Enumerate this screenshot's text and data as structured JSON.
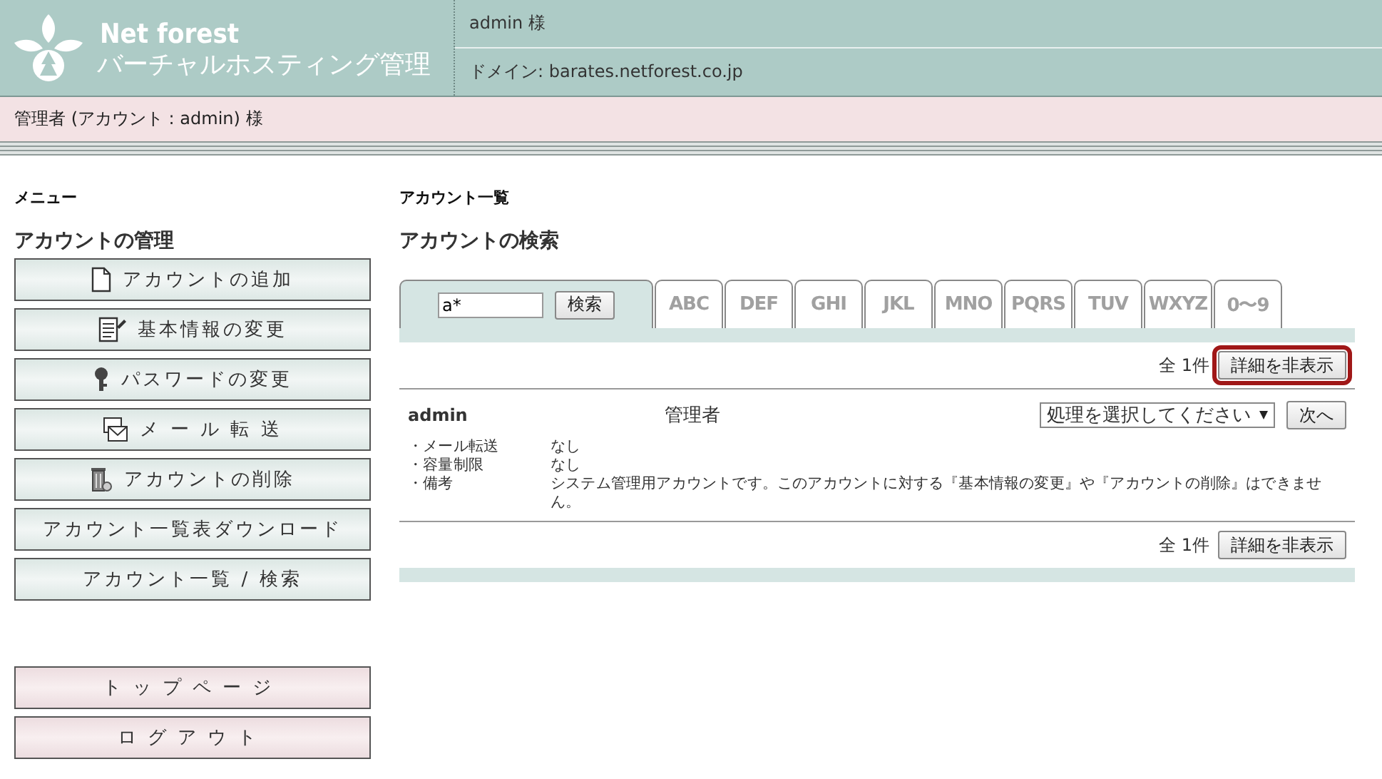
{
  "header": {
    "brand": "Net forest",
    "product": "バーチャルホスティング管理",
    "user": "admin 様",
    "domain": "ドメイン: barates.netforest.co.jp"
  },
  "account_bar": "管理者 (アカウント : admin) 様",
  "sidebar": {
    "title": "メニュー",
    "section": "アカウントの管理",
    "items": [
      {
        "label": "アカウントの追加",
        "kind": "document"
      },
      {
        "label": "基本情報の変更",
        "kind": "edit"
      },
      {
        "label": "パスワードの変更",
        "kind": "key"
      },
      {
        "label": "メ ー ル 転 送",
        "kind": "mail"
      },
      {
        "label": "アカウントの削除",
        "kind": "trash"
      },
      {
        "label": "アカウント一覧表ダウンロード",
        "kind": "plain"
      },
      {
        "label": "アカウント一覧 / 検索",
        "kind": "plain"
      }
    ],
    "bottom_items": [
      {
        "label": "トップページ"
      },
      {
        "label": "ログアウト"
      }
    ]
  },
  "main": {
    "title": "アカウント一覧",
    "subtitle": "アカウントの検索",
    "search": {
      "value": "a*",
      "button": "検索",
      "selected": true
    },
    "tabs": [
      {
        "label": "ABC",
        "selected": false
      },
      {
        "label": "DEF",
        "selected": false
      },
      {
        "label": "GHI",
        "selected": false
      },
      {
        "label": "JKL",
        "selected": false
      },
      {
        "label": "MNO",
        "selected": false
      },
      {
        "label": "PQRS",
        "selected": false
      },
      {
        "label": "TUV",
        "selected": false
      },
      {
        "label": "WXYZ",
        "selected": false
      },
      {
        "label": "0〜9",
        "selected": false
      }
    ],
    "top_bar": {
      "count": "全 1件",
      "button": "詳細を非表示",
      "highlighted": true
    },
    "accounts": [
      {
        "name": "admin",
        "role": "管理者",
        "action": "処理を選択してください",
        "next": "次へ",
        "details": [
          {
            "label": "・メール転送",
            "value": "なし"
          },
          {
            "label": "・容量制限",
            "value": "なし"
          },
          {
            "label": "・備考",
            "value": "システム管理用アカウントです。このアカウントに対する『基本情報の変更』や『アカウントの削除』はできません。"
          }
        ]
      }
    ],
    "bottom_bar": {
      "count": "全 1件",
      "button": "詳細を非表示",
      "highlighted": false
    }
  }
}
